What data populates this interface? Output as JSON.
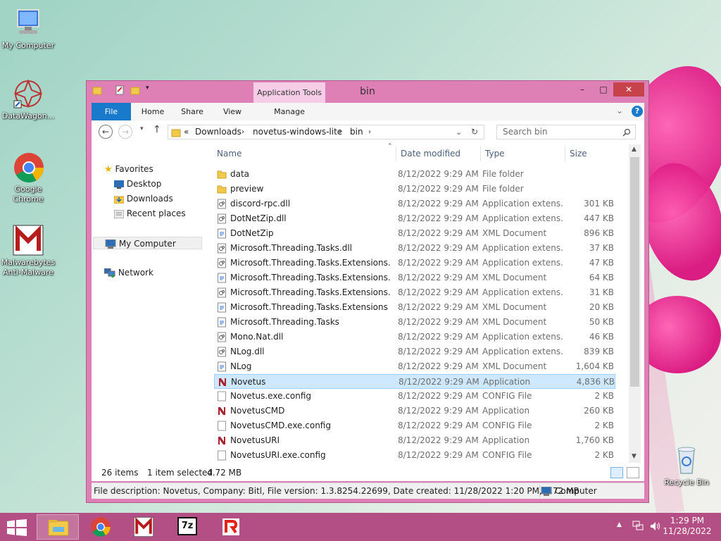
{
  "desktop": {
    "icons": [
      {
        "label": "My Computer"
      },
      {
        "label": "DataWagon..."
      },
      {
        "label": "Google Chrome"
      },
      {
        "label": "Malwarebytes Anti-Malware"
      },
      {
        "label": "Recycle Bin"
      }
    ]
  },
  "window": {
    "title": "bin",
    "contextual_tab": "Application Tools",
    "ribbon_tabs": [
      "File",
      "Home",
      "Share",
      "View",
      "Manage"
    ],
    "address": {
      "prefix": "«",
      "crumbs": [
        "Downloads",
        "novetus-windows-lite",
        "bin"
      ]
    },
    "search_placeholder": "Search bin",
    "nav": {
      "favorites": "Favorites",
      "desktop": "Desktop",
      "downloads": "Downloads",
      "recent": "Recent places",
      "computer": "My Computer",
      "network": "Network"
    },
    "columns": {
      "name": "Name",
      "date": "Date modified",
      "type": "Type",
      "size": "Size"
    },
    "files": [
      {
        "name": "data",
        "date": "8/12/2022 9:29 AM",
        "type": "File folder",
        "size": "",
        "icon": "folder"
      },
      {
        "name": "preview",
        "date": "8/12/2022 9:29 AM",
        "type": "File folder",
        "size": "",
        "icon": "folder"
      },
      {
        "name": "discord-rpc.dll",
        "date": "8/12/2022 9:29 AM",
        "type": "Application extens...",
        "size": "301 KB",
        "icon": "dll"
      },
      {
        "name": "DotNetZip.dll",
        "date": "8/12/2022 9:29 AM",
        "type": "Application extens...",
        "size": "447 KB",
        "icon": "dll"
      },
      {
        "name": "DotNetZip",
        "date": "8/12/2022 9:29 AM",
        "type": "XML Document",
        "size": "896 KB",
        "icon": "xml"
      },
      {
        "name": "Microsoft.Threading.Tasks.dll",
        "date": "8/12/2022 9:29 AM",
        "type": "Application extens...",
        "size": "37 KB",
        "icon": "dll"
      },
      {
        "name": "Microsoft.Threading.Tasks.Extensions.De...",
        "date": "8/12/2022 9:29 AM",
        "type": "Application extens...",
        "size": "47 KB",
        "icon": "dll"
      },
      {
        "name": "Microsoft.Threading.Tasks.Extensions.De...",
        "date": "8/12/2022 9:29 AM",
        "type": "XML Document",
        "size": "64 KB",
        "icon": "xml"
      },
      {
        "name": "Microsoft.Threading.Tasks.Extensions.dll",
        "date": "8/12/2022 9:29 AM",
        "type": "Application extens...",
        "size": "31 KB",
        "icon": "dll"
      },
      {
        "name": "Microsoft.Threading.Tasks.Extensions",
        "date": "8/12/2022 9:29 AM",
        "type": "XML Document",
        "size": "20 KB",
        "icon": "xml"
      },
      {
        "name": "Microsoft.Threading.Tasks",
        "date": "8/12/2022 9:29 AM",
        "type": "XML Document",
        "size": "50 KB",
        "icon": "xml"
      },
      {
        "name": "Mono.Nat.dll",
        "date": "8/12/2022 9:29 AM",
        "type": "Application extens...",
        "size": "46 KB",
        "icon": "dll"
      },
      {
        "name": "NLog.dll",
        "date": "8/12/2022 9:29 AM",
        "type": "Application extens...",
        "size": "839 KB",
        "icon": "dll"
      },
      {
        "name": "NLog",
        "date": "8/12/2022 9:29 AM",
        "type": "XML Document",
        "size": "1,604 KB",
        "icon": "xml"
      },
      {
        "name": "Novetus",
        "date": "8/12/2022 9:29 AM",
        "type": "Application",
        "size": "4,836 KB",
        "icon": "novetus",
        "selected": true
      },
      {
        "name": "Novetus.exe.config",
        "date": "8/12/2022 9:29 AM",
        "type": "CONFIG File",
        "size": "2 KB",
        "icon": "blank"
      },
      {
        "name": "NovetusCMD",
        "date": "8/12/2022 9:29 AM",
        "type": "Application",
        "size": "260 KB",
        "icon": "novetus"
      },
      {
        "name": "NovetusCMD.exe.config",
        "date": "8/12/2022 9:29 AM",
        "type": "CONFIG File",
        "size": "2 KB",
        "icon": "blank"
      },
      {
        "name": "NovetusURI",
        "date": "8/12/2022 9:29 AM",
        "type": "Application",
        "size": "1,760 KB",
        "icon": "novetus"
      },
      {
        "name": "NovetusURI.exe.config",
        "date": "8/12/2022 9:29 AM",
        "type": "CONFIG File",
        "size": "2 KB",
        "icon": "blank"
      }
    ],
    "status": {
      "count": "26 items",
      "selected": "1 item selected",
      "size": "4.72 MB"
    },
    "details": {
      "text": "File description: Novetus, Company: Bitl, File version: 1.3.8254.22699, Date created: 11/28/2022 1:20 PM, 4.72 MB",
      "location": "Computer"
    }
  },
  "taskbar": {
    "time": "1:29 PM",
    "date": "11/28/2022",
    "sevenzip": "7z"
  }
}
